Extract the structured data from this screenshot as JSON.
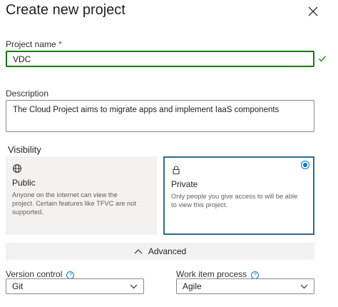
{
  "dialog": {
    "title": "Create new project"
  },
  "project_name": {
    "label": "Project name",
    "required_marker": "*",
    "value": "VDC"
  },
  "description": {
    "label": "Description",
    "value": "The Cloud Project aims to migrate apps and implement IaaS components"
  },
  "visibility": {
    "label": "Visibility",
    "selected": "private",
    "options": [
      {
        "id": "public",
        "title": "Public",
        "icon": "globe-icon",
        "description": "Anyone on the internet can view the project. Certain features like TFVC are not supported."
      },
      {
        "id": "private",
        "title": "Private",
        "icon": "lock-icon",
        "description": "Only people you give access to will be able to view this project."
      }
    ]
  },
  "advanced": {
    "label": "Advanced",
    "expanded": true
  },
  "version_control": {
    "label": "Version control",
    "value": "Git"
  },
  "work_item_process": {
    "label": "Work item process",
    "value": "Agile"
  },
  "colors": {
    "accent": "#0078d4",
    "selected_border": "#2b6a99",
    "valid_border": "#107c10",
    "card_background": "#f3f2f1",
    "required": "#a4262c"
  }
}
